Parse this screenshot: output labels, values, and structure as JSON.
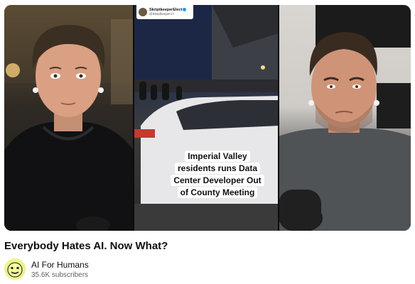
{
  "video": {
    "tweet": {
      "name": "SkriptkeeperElect",
      "handle": "@Skriptkeeper17"
    },
    "caption_lines": [
      "Imperial Valley",
      "residents runs Data",
      "Center Developer Out",
      "of County Meeting"
    ]
  },
  "title": "Everybody Hates AI. Now What?",
  "channel": {
    "name": "AI For Humans",
    "subscribers": "35.6K subscribers",
    "avatar_icon": "smiley-face-icon"
  },
  "colors": {
    "title_text": "#0f0f0f",
    "subtext": "#606060",
    "avatar_bg": "#e9f58c",
    "verified": "#1d9bf0"
  }
}
